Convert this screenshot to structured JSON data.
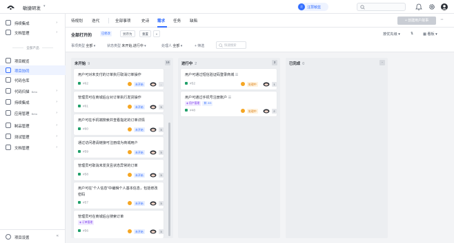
{
  "app": {
    "project_name": "敏捷研发"
  },
  "user": {
    "initials": "汪",
    "name": "汪慧敏蓝"
  },
  "colors": {
    "accent": "#2f6bff",
    "priority": "#f5a623",
    "in_progress": "#d97706",
    "success": "#22a06b"
  },
  "sidebar": {
    "items_top": [
      {
        "label": "持续集成"
      },
      {
        "label": "文档管理"
      }
    ],
    "section_label": "全部产品",
    "items": [
      {
        "label": "项目概览",
        "badge": ""
      },
      {
        "label": "项目协同",
        "badge": ""
      },
      {
        "label": "代码仓库",
        "badge": ""
      },
      {
        "label": "代码扫描",
        "badge": "Beta"
      },
      {
        "label": "持续集成",
        "badge": ""
      },
      {
        "label": "应用管理",
        "badge": "Beta"
      },
      {
        "label": "制品管理",
        "badge": ""
      },
      {
        "label": "测试管理",
        "badge": ""
      },
      {
        "label": "文档管理",
        "badge": ""
      }
    ],
    "footer_label": "项目设置"
  },
  "tabs": {
    "items": [
      "待规划",
      "迭代",
      "全部事项",
      "史诗",
      "需求",
      "任务",
      "缺陷"
    ],
    "active": "需求",
    "create_button": "+ 创建用户故事"
  },
  "filters": {
    "view_title": "全部打开的",
    "view_badge": "已修改",
    "save_as": "另存为",
    "reset": "重置",
    "sort": "按优先级",
    "view_mode": "看板",
    "type_label": "事项类型",
    "type_value": "全部",
    "status_label": "状态类型",
    "status_value": "未开始,进行中",
    "assignee_label": "处理人",
    "assignee_value": "全部",
    "add_filter": "+ 筛选",
    "search_placeholder": "快速搜索"
  },
  "board": {
    "columns": [
      {
        "title": "未开始",
        "count": "9",
        "button": "19"
      },
      {
        "title": "进行中",
        "count": "2",
        "button": "3"
      },
      {
        "title": "已完成",
        "count": "0",
        "button": "-"
      }
    ],
    "todo_cards": [
      {
        "title": "用户可对未支付的订单执行取消订单操作",
        "id": "#62",
        "status": "未开始",
        "comments": "-"
      },
      {
        "title": "管理员可在商城后台对订单执行发货操作",
        "id": "#61",
        "status": "未开始",
        "comments": "3"
      },
      {
        "title": "用户可在手机端搜索并查看指定的订单详情",
        "id": "#60",
        "status": "未开始",
        "comments": "3"
      },
      {
        "title": "通过访问邀请链接可注册成为商城用户",
        "id": "#59",
        "status": "未开始",
        "comments": "3"
      },
      {
        "title": "管理员可取消未发货且状态异常的订单",
        "id": "#58",
        "status": "未开始",
        "comments": "3"
      },
      {
        "title": "用户可在“个人信息”中编辑个人基本信息，包括修改密码",
        "id": "#57",
        "status": "未开始",
        "comments": "3"
      },
      {
        "title": "管理员可在商城后台搜索订单",
        "tag": "订单管理",
        "id": "#56",
        "status": "未开始",
        "comments": "3"
      }
    ],
    "doing_cards": [
      {
        "title": "用户可通过短信验证码登录商城",
        "id": "#52",
        "status": "处理中",
        "comments": "1"
      },
      {
        "title": "用户可通过手机号注册账户",
        "tag": "用户管理",
        "tag2": "2/3",
        "id": "#48",
        "status": "处理中",
        "comments": "2"
      }
    ]
  }
}
